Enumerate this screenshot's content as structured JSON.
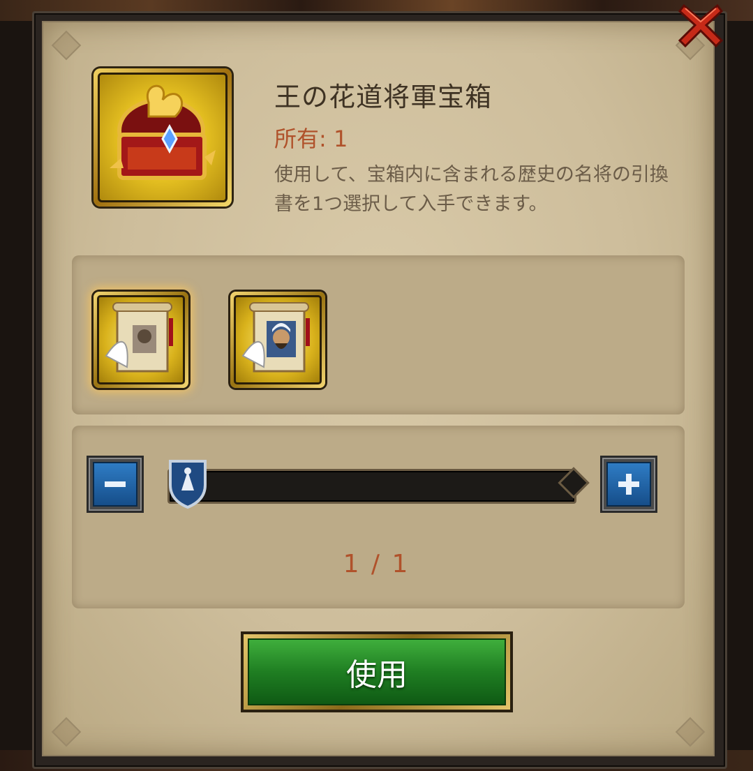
{
  "item": {
    "title": "王の花道将軍宝箱",
    "owned_text": "所有: 1",
    "description": "使用して、宝箱内に含まれる歴史の名将の引換書を1つ選択して入手できます。"
  },
  "rewards": [
    {
      "icon": "generic-hero-scroll-icon",
      "selected": true
    },
    {
      "icon": "general-portrait-scroll-icon",
      "selected": false
    }
  ],
  "quantity": {
    "current": 1,
    "max": 1,
    "display": "1 / 1",
    "decrease_icon": "minus-icon",
    "increase_icon": "plus-icon"
  },
  "actions": {
    "use_label": "使用",
    "close_icon": "close-x-icon"
  },
  "colors": {
    "owned_text": "#b0522b",
    "use_button": "#1f7e22",
    "step_button": "#2f7cc4"
  }
}
